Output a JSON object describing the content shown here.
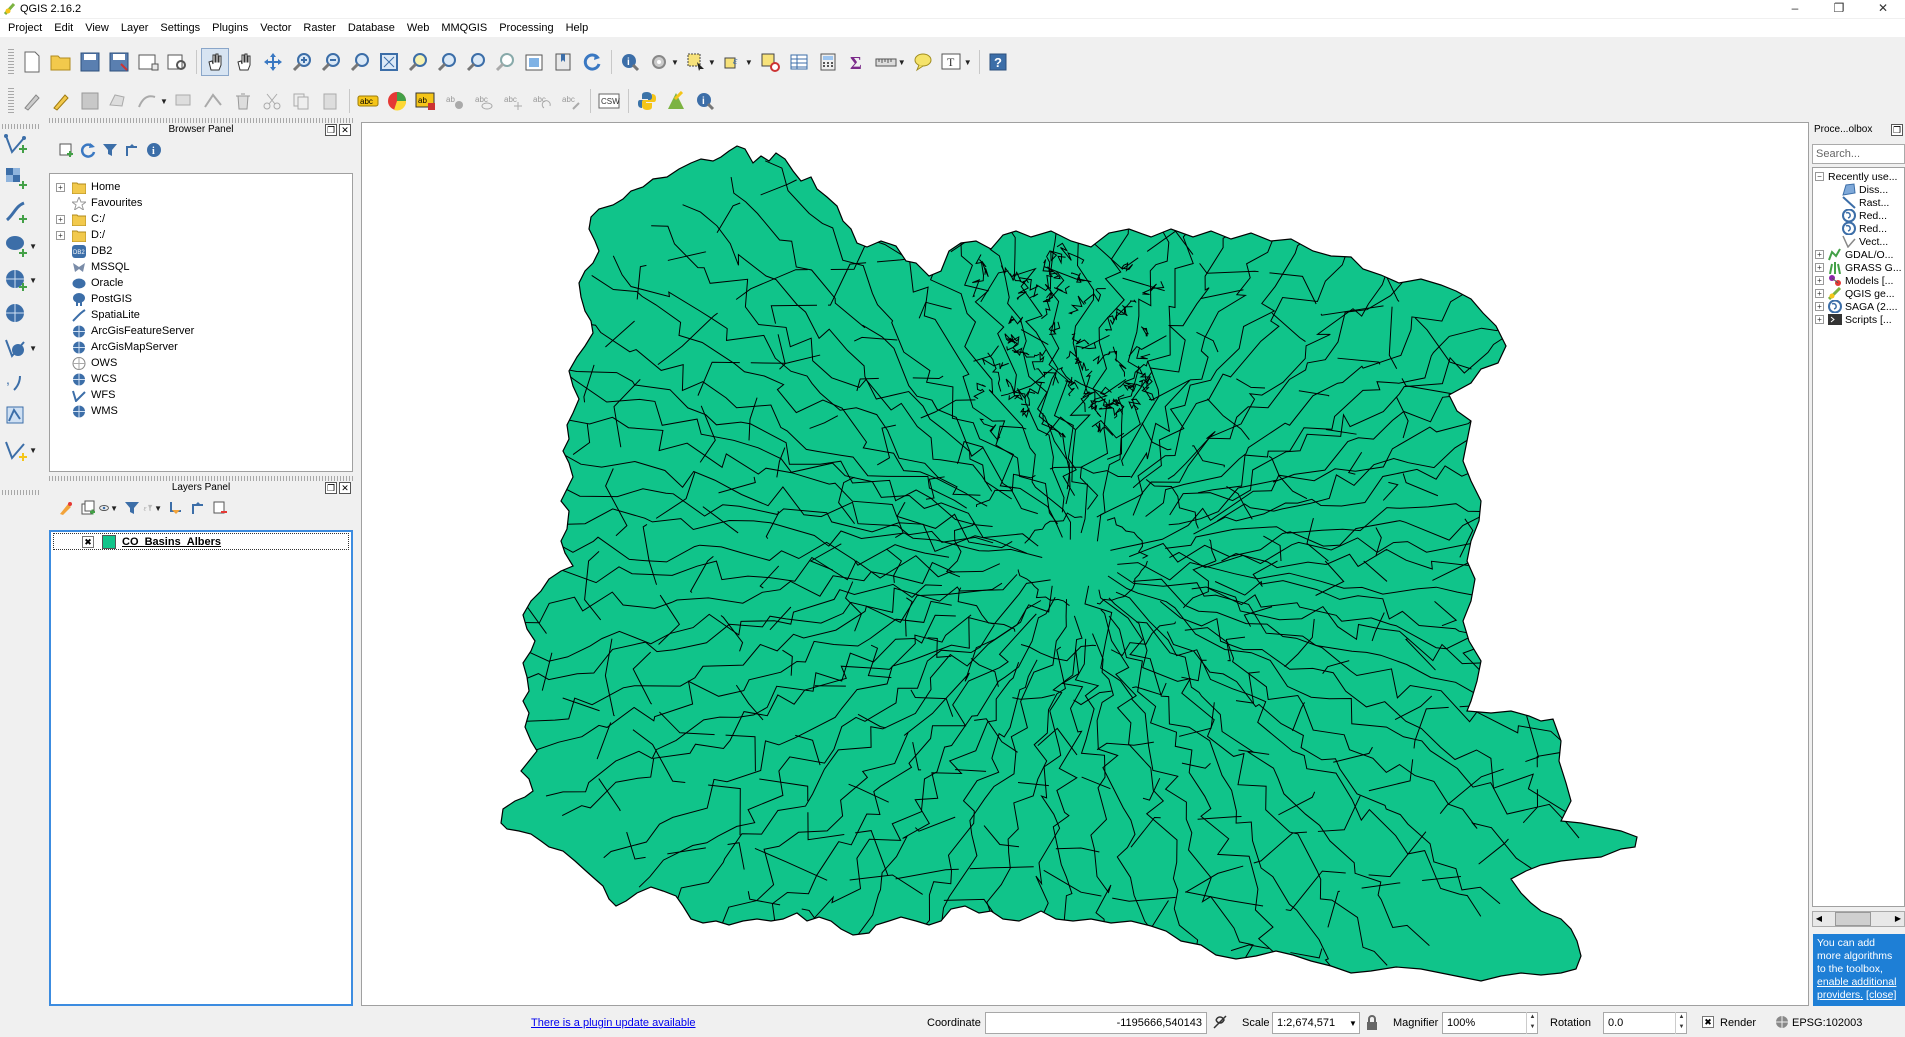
{
  "window": {
    "title": "QGIS 2.16.2",
    "minimize": "–",
    "maximize": "❐",
    "close": "✕"
  },
  "menu": [
    "Project",
    "Edit",
    "View",
    "Layer",
    "Settings",
    "Plugins",
    "Vector",
    "Raster",
    "Database",
    "Web",
    "MMQGIS",
    "Processing",
    "Help"
  ],
  "browser_panel": {
    "title": "Browser Panel",
    "items": [
      {
        "label": "Home",
        "icon": "folder-icon",
        "expandable": true
      },
      {
        "label": "Favourites",
        "icon": "star-icon",
        "expandable": false
      },
      {
        "label": "C:/",
        "icon": "folder-icon",
        "expandable": true
      },
      {
        "label": "D:/",
        "icon": "folder-icon",
        "expandable": true
      },
      {
        "label": "DB2",
        "icon": "db2-icon",
        "expandable": false
      },
      {
        "label": "MSSQL",
        "icon": "mssql-icon",
        "expandable": false
      },
      {
        "label": "Oracle",
        "icon": "oracle-icon",
        "expandable": false
      },
      {
        "label": "PostGIS",
        "icon": "postgis-icon",
        "expandable": false
      },
      {
        "label": "SpatiaLite",
        "icon": "spatialite-icon",
        "expandable": false
      },
      {
        "label": "ArcGisFeatureServer",
        "icon": "globe-icon",
        "expandable": false
      },
      {
        "label": "ArcGisMapServer",
        "icon": "globe-icon",
        "expandable": false
      },
      {
        "label": "OWS",
        "icon": "ows-icon",
        "expandable": false
      },
      {
        "label": "WCS",
        "icon": "globe-icon",
        "expandable": false
      },
      {
        "label": "WFS",
        "icon": "wfs-icon",
        "expandable": false
      },
      {
        "label": "WMS",
        "icon": "globe-icon",
        "expandable": false
      }
    ]
  },
  "layers_panel": {
    "title": "Layers Panel",
    "layers": [
      {
        "name": "CO_Basins_Albers",
        "checked": "✖",
        "color": "#10c48a"
      }
    ]
  },
  "processing_panel": {
    "title": "Proce...olbox",
    "search_placeholder": "Search...",
    "tree": [
      {
        "label": "Recently use...",
        "level": 0,
        "expand": "−",
        "icon": ""
      },
      {
        "label": "Diss...",
        "level": 1,
        "expand": "",
        "icon": "dissolve-icon"
      },
      {
        "label": "Rast...",
        "level": 1,
        "expand": "",
        "icon": "raster-tool-icon"
      },
      {
        "label": "Red...",
        "level": 1,
        "expand": "",
        "icon": "saga-icon"
      },
      {
        "label": "Red...",
        "level": 1,
        "expand": "",
        "icon": "saga-icon"
      },
      {
        "label": "Vect...",
        "level": 1,
        "expand": "",
        "icon": "vector-tool-icon"
      },
      {
        "label": "GDAL/O...",
        "level": 0,
        "expand": "+",
        "icon": "gdal-icon"
      },
      {
        "label": "GRASS G...",
        "level": 0,
        "expand": "+",
        "icon": "grass-icon"
      },
      {
        "label": "Models [...",
        "level": 0,
        "expand": "+",
        "icon": "models-icon"
      },
      {
        "label": "QGIS ge...",
        "level": 0,
        "expand": "+",
        "icon": "qgis-icon"
      },
      {
        "label": "SAGA (2....",
        "level": 0,
        "expand": "+",
        "icon": "saga-icon"
      },
      {
        "label": "Scripts [...",
        "level": 0,
        "expand": "+",
        "icon": "scripts-icon"
      }
    ],
    "info_text": "You can add more algorithms to the toolbox,",
    "info_link1": "enable additional providers.",
    "info_link2": "[close]"
  },
  "status": {
    "plugin_update": "There is a plugin update available",
    "coordinate_label": "Coordinate",
    "coordinate_value": "-1195666,540143",
    "scale_label": "Scale",
    "scale_value": "1:2,674,571",
    "magnifier_label": "Magnifier",
    "magnifier_value": "100%",
    "rotation_label": "Rotation",
    "rotation_value": "0.0",
    "render_label": "Render",
    "render_checked": "✖",
    "crs": "EPSG:102003"
  },
  "map": {
    "fill_color": "#10c48a",
    "stroke_color": "#000000"
  }
}
